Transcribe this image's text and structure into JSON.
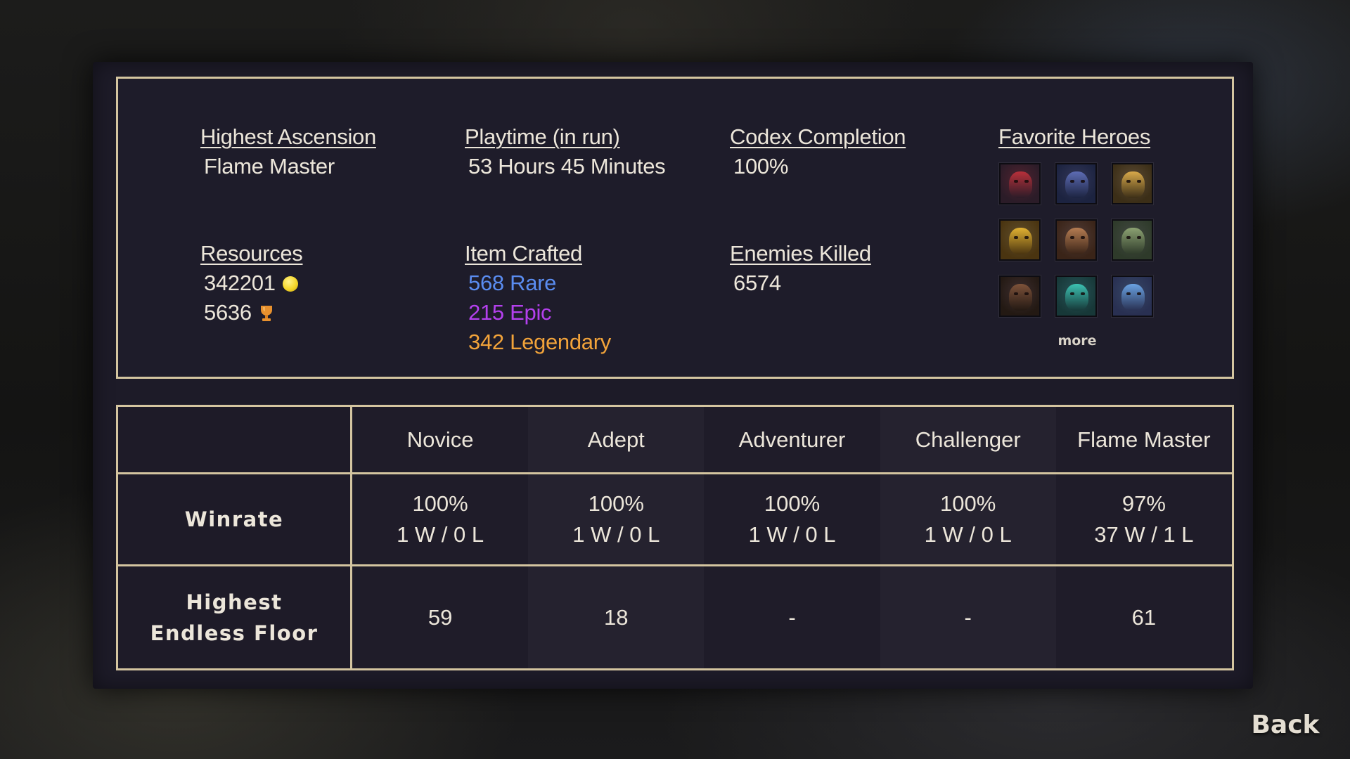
{
  "stats": {
    "highest_ascension": {
      "label": "Highest Ascension",
      "value": "Flame Master"
    },
    "playtime": {
      "label": "Playtime (in run)",
      "value": "53 Hours 45 Minutes"
    },
    "codex": {
      "label": "Codex Completion",
      "value": "100%"
    },
    "resources": {
      "label": "Resources",
      "gold": "342201",
      "gold_icon": "gold-coin-icon",
      "trophies": "5636",
      "trophy_icon": "trophy-icon"
    },
    "items": {
      "label": "Item Crafted",
      "rare": "568 Rare",
      "epic": "215 Epic",
      "legendary": "342 Legendary"
    },
    "enemies": {
      "label": "Enemies Killed",
      "value": "6574"
    }
  },
  "favorite_heroes": {
    "label": "Favorite Heroes",
    "more": "more",
    "heroes": [
      {
        "icon": "red-hooded-hero-icon",
        "bg": "#2b1c28",
        "accent": "#b8303a"
      },
      {
        "icon": "blue-armored-hero-icon",
        "bg": "#1c2340",
        "accent": "#5d6cb4"
      },
      {
        "icon": "golden-golem-hero-icon",
        "bg": "#3b2e17",
        "accent": "#d8a94a"
      },
      {
        "icon": "golden-winged-hero-icon",
        "bg": "#4a3410",
        "accent": "#e2b232"
      },
      {
        "icon": "skull-warrior-hero-icon",
        "bg": "#3a2418",
        "accent": "#b57c52"
      },
      {
        "icon": "green-orc-hero-icon",
        "bg": "#2e3a2a",
        "accent": "#8ca272"
      },
      {
        "icon": "bearded-man-hero-icon",
        "bg": "#231913",
        "accent": "#7d523a"
      },
      {
        "icon": "teal-creature-hero-icon",
        "bg": "#173838",
        "accent": "#3cc2b2"
      },
      {
        "icon": "blue-haired-hero-icon",
        "bg": "#293052",
        "accent": "#6aa2e2"
      }
    ]
  },
  "table": {
    "columns": [
      "Novice",
      "Adept",
      "Adventurer",
      "Challenger",
      "Flame Master"
    ],
    "winrate": {
      "label": "Winrate",
      "cells": [
        {
          "pct": "100%",
          "record": "1 W / 0 L"
        },
        {
          "pct": "100%",
          "record": "1 W / 0 L"
        },
        {
          "pct": "100%",
          "record": "1 W / 0 L"
        },
        {
          "pct": "100%",
          "record": "1 W / 0 L"
        },
        {
          "pct": "97%",
          "record": "37 W / 1 L"
        }
      ]
    },
    "endless": {
      "label_line1": "Highest",
      "label_line2": "Endless Floor",
      "cells": [
        "59",
        "18",
        "-",
        "-",
        "61"
      ]
    }
  },
  "back_label": "Back",
  "colors": {
    "border": "#d4c5a0",
    "text": "#ece6da",
    "rare": "#5a8cf0",
    "epic": "#b440ee",
    "legendary": "#f2a33a",
    "coin": "#f5d72a",
    "trophy": "#e8912e"
  }
}
